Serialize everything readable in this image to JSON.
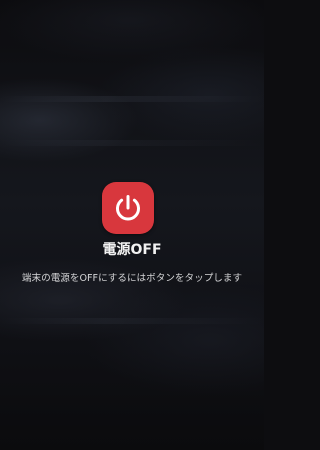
{
  "power_dialog": {
    "icon": "power-icon",
    "title": "電源OFF",
    "hint": "端末の電源をOFFにするにはボタンをタップします",
    "button_color": "#d8373d"
  }
}
